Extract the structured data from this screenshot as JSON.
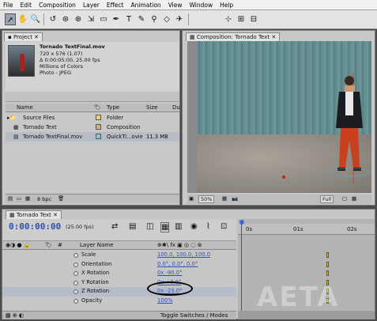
{
  "menu": [
    "File",
    "Edit",
    "Composition",
    "Layer",
    "Effect",
    "Animation",
    "View",
    "Window",
    "Help"
  ],
  "toolbar_icons": [
    "selection-tool-icon",
    "hand-tool-icon",
    "zoom-tool-icon",
    "rotate-tool-icon",
    "orbit-camera-icon",
    "pan-behind-icon",
    "rectangle-mask-icon",
    "pen-tool-icon",
    "type-tool-icon",
    "brush-tool-icon",
    "clone-stamp-icon",
    "eraser-icon",
    "puppet-pin-icon",
    "axis-mode-icon"
  ],
  "project": {
    "tab": "Project",
    "info": {
      "name": "Tornado TextFinal.mov",
      "line1": "720 x 576 (1.07)",
      "line2": "Δ 0:00:05:00, 25.00 fps",
      "line3": "Millions of Colors",
      "line4": "Photo - JPEG"
    },
    "columns": {
      "name": "Name",
      "type": "Type",
      "size": "Size",
      "du": "Du"
    },
    "files": [
      {
        "name": "Source Files",
        "type": "Folder",
        "size": "",
        "color": "#e8d27a"
      },
      {
        "name": "Tornado Text",
        "type": "Composition",
        "size": "",
        "color": "#c9b98a"
      },
      {
        "name": "Tornado TextFinal.mov",
        "type": "QuickTi...ovie",
        "size": "11.3 MB",
        "color": "#8fc3c6"
      }
    ],
    "bpc": "8 bpc"
  },
  "composition": {
    "tab": "Composition: Tornado Text",
    "zoom": "50%",
    "resolution": "Full"
  },
  "timeline": {
    "tab": "Tornado Text",
    "time": "0:00:00:00",
    "fps": "(25.00 fps)",
    "layer_name_header": "Layer Name",
    "ruler": [
      "0s",
      "01s",
      "02s"
    ],
    "properties": [
      {
        "name": "Scale",
        "value": "100.0, 100.0, 100.0"
      },
      {
        "name": "Orientation",
        "value": "0.0°, 0.0°, 0.0°"
      },
      {
        "name": "X Rotation",
        "value": "0x -90.0°"
      },
      {
        "name": "Y Rotation",
        "value": "0x +0.0°"
      },
      {
        "name": "Z Rotation",
        "value": "0x -23.0°"
      },
      {
        "name": "Opacity",
        "value": "100%"
      }
    ],
    "toggle_label": "Toggle Switches / Modes"
  },
  "watermark": "AETA"
}
